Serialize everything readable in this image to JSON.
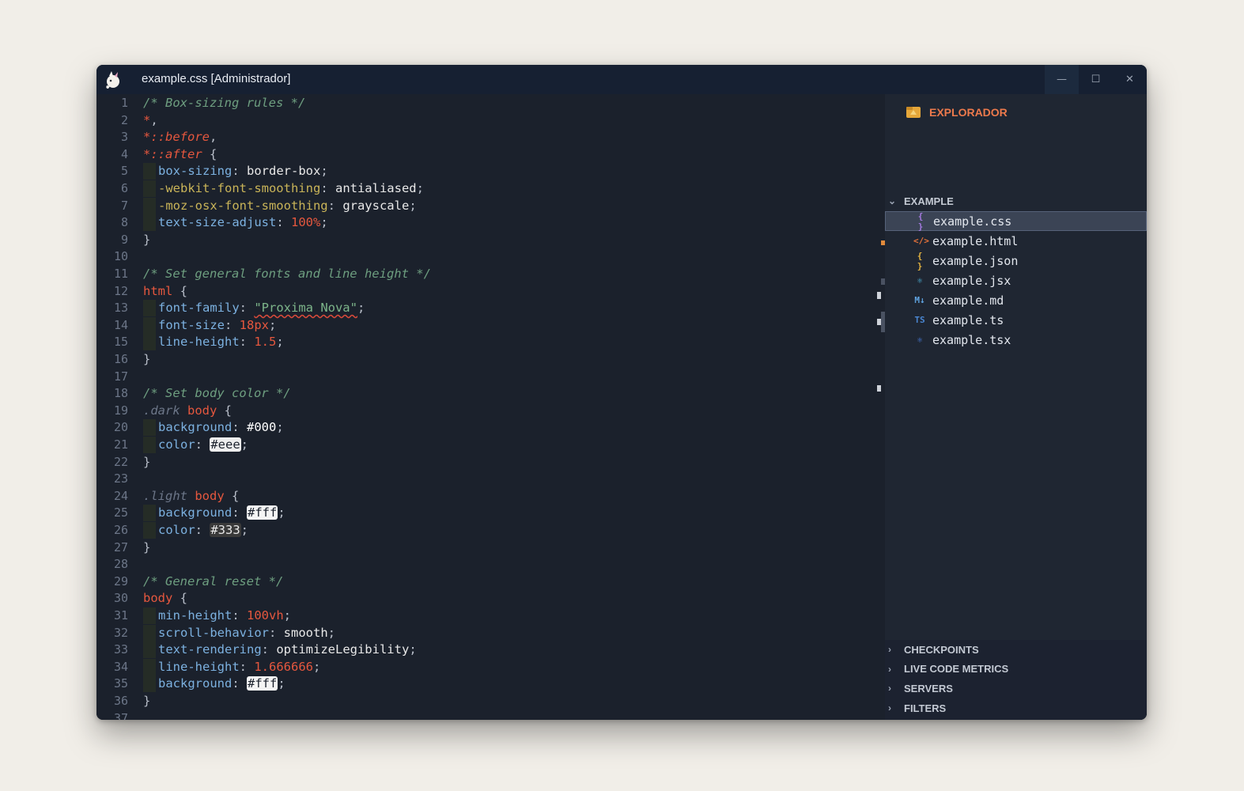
{
  "window": {
    "title": "example.css [Administrador]",
    "controls": {
      "minimize": "—",
      "maximize": "☐",
      "close": "✕"
    }
  },
  "editor": {
    "line_numbers": [
      "1",
      "2",
      "3",
      "4",
      "5",
      "6",
      "7",
      "8",
      "9",
      "10",
      "11",
      "12",
      "13",
      "14",
      "15",
      "16",
      "17",
      "18",
      "19",
      "20",
      "21",
      "22",
      "23",
      "24",
      "25",
      "26",
      "27",
      "28",
      "29",
      "30",
      "31",
      "32",
      "33",
      "34",
      "35",
      "36",
      "37"
    ],
    "lines": [
      {
        "t": [
          [
            "c-comment",
            "/* Box-sizing rules */"
          ]
        ]
      },
      {
        "t": [
          [
            "c-star",
            "*"
          ],
          [
            "c-punc",
            ","
          ]
        ]
      },
      {
        "t": [
          [
            "c-star",
            "*"
          ],
          [
            "c-pseudo",
            "::before"
          ],
          [
            "c-punc",
            ","
          ]
        ]
      },
      {
        "t": [
          [
            "c-star",
            "*"
          ],
          [
            "c-pseudo",
            "::after"
          ],
          [
            "c-brace",
            " {"
          ]
        ]
      },
      {
        "i": true,
        "t": [
          [
            "c-prop",
            "box-sizing"
          ],
          [
            "c-punc",
            ": "
          ],
          [
            "c-value",
            "border-box"
          ],
          [
            "c-punc",
            ";"
          ]
        ]
      },
      {
        "i": true,
        "t": [
          [
            "c-vendor",
            "-webkit-font-smoothing"
          ],
          [
            "c-punc",
            ": "
          ],
          [
            "c-value",
            "antialiased"
          ],
          [
            "c-punc",
            ";"
          ]
        ]
      },
      {
        "i": true,
        "t": [
          [
            "c-vendor",
            "-moz-osx-font-smoothing"
          ],
          [
            "c-punc",
            ": "
          ],
          [
            "c-value",
            "grayscale"
          ],
          [
            "c-punc",
            ";"
          ]
        ]
      },
      {
        "i": true,
        "t": [
          [
            "c-prop",
            "text-size-adjust"
          ],
          [
            "c-punc",
            ": "
          ],
          [
            "c-num",
            "100"
          ],
          [
            "c-unit",
            "%"
          ],
          [
            "c-punc",
            ";"
          ]
        ]
      },
      {
        "t": [
          [
            "c-brace",
            "}"
          ]
        ]
      },
      {
        "t": []
      },
      {
        "t": [
          [
            "c-comment",
            "/* Set general fonts and line height */"
          ]
        ]
      },
      {
        "t": [
          [
            "c-tag",
            "html"
          ],
          [
            "c-brace",
            " {"
          ]
        ]
      },
      {
        "i": true,
        "t": [
          [
            "c-prop",
            "font-family"
          ],
          [
            "c-punc",
            ": "
          ],
          [
            "c-str",
            "\"Proxima Nova\""
          ],
          [
            "c-punc",
            ";"
          ]
        ]
      },
      {
        "i": true,
        "t": [
          [
            "c-prop",
            "font-size"
          ],
          [
            "c-punc",
            ": "
          ],
          [
            "c-num",
            "18"
          ],
          [
            "c-unit",
            "px"
          ],
          [
            "c-punc",
            ";"
          ]
        ]
      },
      {
        "i": true,
        "t": [
          [
            "c-prop",
            "line-height"
          ],
          [
            "c-punc",
            ": "
          ],
          [
            "c-num",
            "1.5"
          ],
          [
            "c-punc",
            ";"
          ]
        ]
      },
      {
        "t": [
          [
            "c-brace",
            "}"
          ]
        ]
      },
      {
        "t": []
      },
      {
        "t": [
          [
            "c-comment",
            "/* Set body color */"
          ]
        ]
      },
      {
        "t": [
          [
            "c-class",
            ".dark"
          ],
          [
            "c-tag",
            " body"
          ],
          [
            "c-brace",
            " {"
          ]
        ]
      },
      {
        "i": true,
        "t": [
          [
            "c-prop",
            "background"
          ],
          [
            "c-punc",
            ": "
          ],
          [
            "swatch-000",
            "#000"
          ],
          [
            "c-punc",
            ";"
          ]
        ]
      },
      {
        "i": true,
        "t": [
          [
            "c-prop",
            "color"
          ],
          [
            "c-punc",
            ": "
          ],
          [
            "swatch-eee",
            "#eee"
          ],
          [
            "c-punc",
            ";"
          ]
        ]
      },
      {
        "t": [
          [
            "c-brace",
            "}"
          ]
        ]
      },
      {
        "t": []
      },
      {
        "t": [
          [
            "c-class",
            ".light"
          ],
          [
            "c-tag",
            " body"
          ],
          [
            "c-brace",
            " {"
          ]
        ]
      },
      {
        "i": true,
        "t": [
          [
            "c-prop",
            "background"
          ],
          [
            "c-punc",
            ": "
          ],
          [
            "swatch-light",
            "#fff"
          ],
          [
            "c-punc",
            ";"
          ]
        ]
      },
      {
        "i": true,
        "t": [
          [
            "c-prop",
            "color"
          ],
          [
            "c-punc",
            ": "
          ],
          [
            "swatch-333",
            "#333"
          ],
          [
            "c-punc",
            ";"
          ]
        ]
      },
      {
        "t": [
          [
            "c-brace",
            "}"
          ]
        ]
      },
      {
        "t": []
      },
      {
        "t": [
          [
            "c-comment",
            "/* General reset */"
          ]
        ]
      },
      {
        "t": [
          [
            "c-tag",
            "body"
          ],
          [
            "c-brace",
            " {"
          ]
        ]
      },
      {
        "i": true,
        "t": [
          [
            "c-prop",
            "min-height"
          ],
          [
            "c-punc",
            ": "
          ],
          [
            "c-num",
            "100"
          ],
          [
            "c-unit",
            "vh"
          ],
          [
            "c-punc",
            ";"
          ]
        ]
      },
      {
        "i": true,
        "t": [
          [
            "c-prop",
            "scroll-behavior"
          ],
          [
            "c-punc",
            ": "
          ],
          [
            "c-value",
            "smooth"
          ],
          [
            "c-punc",
            ";"
          ]
        ]
      },
      {
        "i": true,
        "t": [
          [
            "c-prop",
            "text-rendering"
          ],
          [
            "c-punc",
            ": "
          ],
          [
            "c-value",
            "optimizeLegibility"
          ],
          [
            "c-punc",
            ";"
          ]
        ]
      },
      {
        "i": true,
        "t": [
          [
            "c-prop",
            "line-height"
          ],
          [
            "c-punc",
            ": "
          ],
          [
            "c-num",
            "1.666666"
          ],
          [
            "c-punc",
            ";"
          ]
        ]
      },
      {
        "i": true,
        "t": [
          [
            "c-prop",
            "background"
          ],
          [
            "c-punc",
            ": "
          ],
          [
            "swatch-light",
            "#fff"
          ],
          [
            "c-punc",
            ";"
          ]
        ]
      },
      {
        "t": [
          [
            "c-brace",
            "}"
          ]
        ]
      },
      {
        "t": []
      }
    ]
  },
  "sidebar": {
    "explorer_title": "EXPLORADOR",
    "folder": {
      "label": "EXAMPLE",
      "expanded": true
    },
    "files": [
      {
        "name": "example.css",
        "icon": "css-braces-icon",
        "glyph": "{ }",
        "color": "#a47ae0",
        "active": true
      },
      {
        "name": "example.html",
        "icon": "html-code-icon",
        "glyph": "</>",
        "color": "#e8733a",
        "active": false
      },
      {
        "name": "example.json",
        "icon": "json-braces-icon",
        "glyph": "{ }",
        "color": "#e3b341",
        "active": false
      },
      {
        "name": "example.jsx",
        "icon": "react-icon",
        "glyph": "⚛",
        "color": "#4fb3d9",
        "active": false
      },
      {
        "name": "example.md",
        "icon": "markdown-icon",
        "glyph": "M↓",
        "color": "#5fa3e0",
        "active": false
      },
      {
        "name": "example.ts",
        "icon": "typescript-icon",
        "glyph": "TS",
        "color": "#4a86d1",
        "active": false
      },
      {
        "name": "example.tsx",
        "icon": "react-icon",
        "glyph": "⚛",
        "color": "#4a7fe0",
        "active": false
      }
    ],
    "sections": [
      {
        "label": "CHECKPOINTS"
      },
      {
        "label": "LIVE CODE METRICS"
      },
      {
        "label": "SERVERS"
      },
      {
        "label": "FILTERS"
      }
    ]
  },
  "colors": {
    "accent": "#ee7a4c",
    "editor_bg": "#1b212c",
    "sidebar_bg": "#1f2632"
  }
}
